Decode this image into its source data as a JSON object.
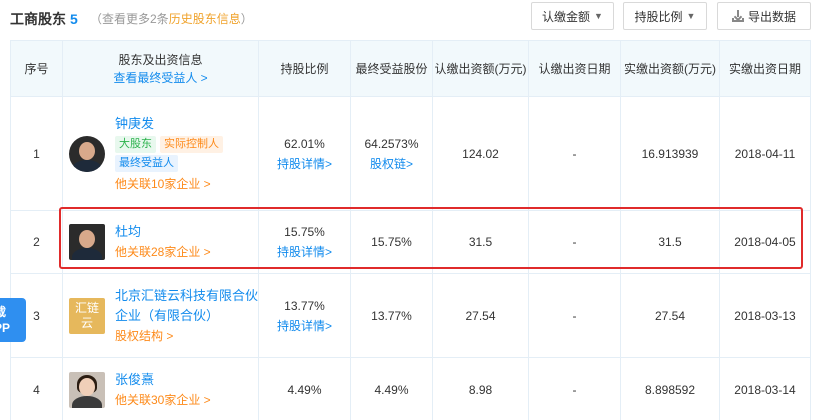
{
  "header": {
    "title": "工商股东",
    "count": "5",
    "sub_prefix": "（查看更多2条",
    "sub_link": "历史股东信息",
    "sub_suffix": "）",
    "btn_subscribed": "认缴金额",
    "btn_ratio": "持股比例",
    "btn_export": "导出数据"
  },
  "columns": {
    "index": "序号",
    "holder": "股东及出资信息",
    "holder_link": "查看最终受益人 >",
    "ratio": "持股比例",
    "final_ratio": "最终受益股份",
    "sub_amount": "认缴出资额(万元)",
    "sub_date": "认缴出资日期",
    "paid_amount": "实缴出资额(万元)",
    "paid_date": "实缴出资日期"
  },
  "rows": [
    {
      "index": "1",
      "name": "钟庚发",
      "tags": [
        "大股东",
        "实际控制人",
        "最终受益人"
      ],
      "rel": "他关联10家企业 >",
      "ratio": "62.01%",
      "ratio_link": "持股详情>",
      "final_ratio": "64.2573%",
      "final_link": "股权链>",
      "sub_amount": "124.02",
      "sub_date": "-",
      "paid_amount": "16.913939",
      "paid_date": "2018-04-11"
    },
    {
      "index": "2",
      "name": "杜均",
      "rel": "他关联28家企业 >",
      "ratio": "15.75%",
      "ratio_link": "持股详情>",
      "final_ratio": "15.75%",
      "sub_amount": "31.5",
      "sub_date": "-",
      "paid_amount": "31.5",
      "paid_date": "2018-04-05"
    },
    {
      "index": "3",
      "logo_text_1": "汇链",
      "logo_text_2": "云",
      "name_line1": "北京汇链云科技有限合伙",
      "name_line2": "企业（有限合伙）",
      "rel": "股权结构 >",
      "ratio": "13.77%",
      "ratio_link": "持股详情>",
      "final_ratio": "13.77%",
      "sub_amount": "27.54",
      "sub_date": "-",
      "paid_amount": "27.54",
      "paid_date": "2018-03-13"
    },
    {
      "index": "4",
      "name": "张俊熹",
      "rel": "他关联30家企业 >",
      "ratio": "4.49%",
      "final_ratio": "4.49%",
      "sub_amount": "8.98",
      "sub_date": "-",
      "paid_amount": "8.898592",
      "paid_date": "2018-03-14"
    }
  ],
  "side_tab": {
    "line1": "载",
    "line2": "PP"
  },
  "colors": {
    "accent": "#128bed",
    "orange": "#fd8a1a",
    "highlight": "#e02b2b"
  }
}
